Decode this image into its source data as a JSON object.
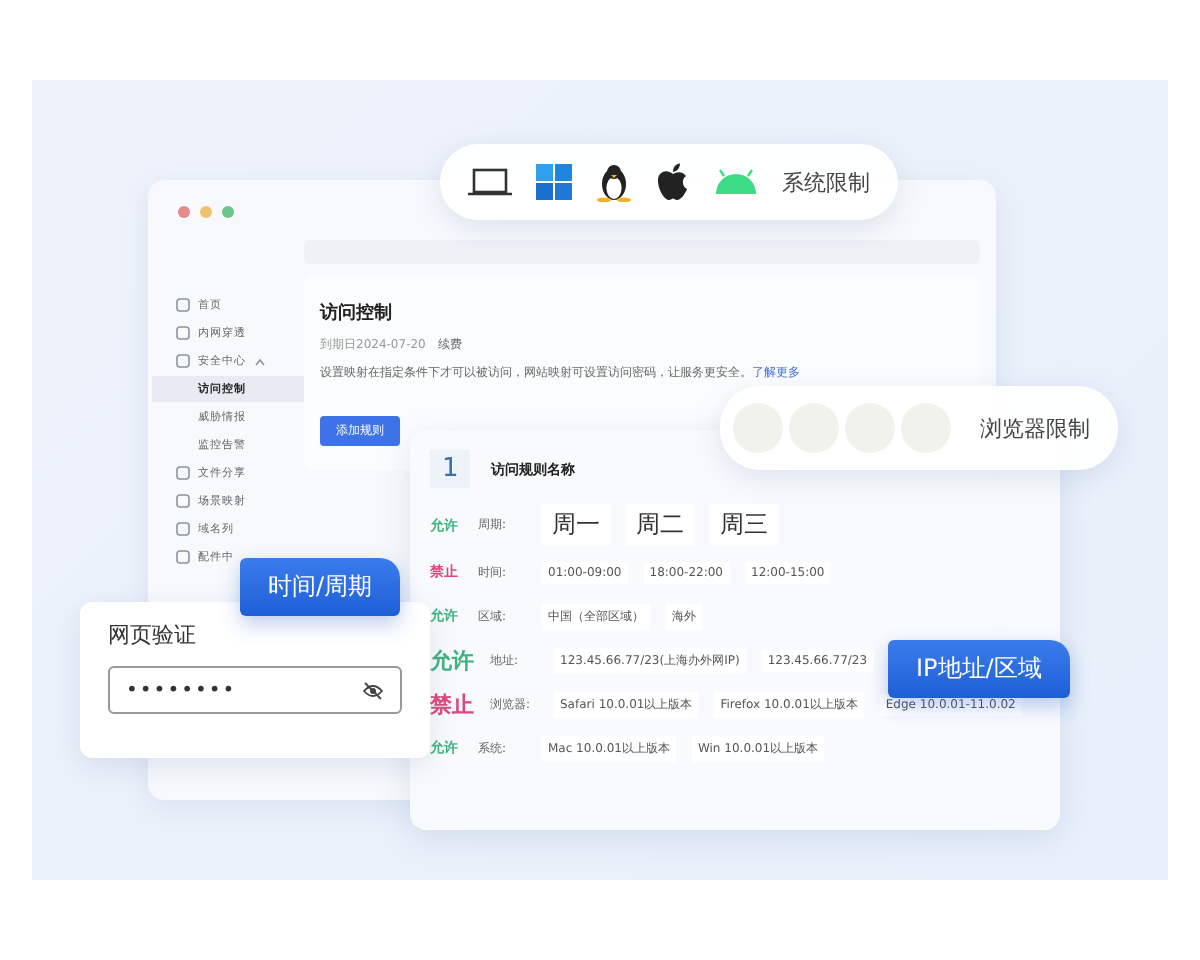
{
  "os_restriction": {
    "label": "系统限制"
  },
  "browser_restriction": {
    "label": "浏览器限制"
  },
  "sidebar": {
    "items": [
      {
        "label": "首页",
        "selected": false
      },
      {
        "label": "内网穿透",
        "selected": false
      },
      {
        "label": "安全中心",
        "selected": false,
        "expanded": true,
        "children": [
          {
            "label": "访问控制",
            "selected": true
          },
          {
            "label": "威胁情报",
            "selected": false
          },
          {
            "label": "监控告警",
            "selected": false
          }
        ]
      },
      {
        "label": "文件分享",
        "selected": false
      },
      {
        "label": "场景映射",
        "selected": false
      },
      {
        "label": "域名列",
        "selected": false
      },
      {
        "label": "配件中",
        "selected": false
      }
    ]
  },
  "page": {
    "title": "访问控制",
    "expiry": "到期日2024-07-20",
    "renew": "续费",
    "description": "设置映射在指定条件下才可以被访问，网站映射可设置访问密码，让服务更安全。",
    "learn_more": "了解更多",
    "add_button": "添加规则"
  },
  "rule": {
    "index": "1",
    "name": "访问规则名称",
    "rows": [
      {
        "status": "允许",
        "color": "#3fb27f",
        "emphasized": false,
        "label": "周期:",
        "kind": "large",
        "values": [
          "周一",
          "周二",
          "周三"
        ]
      },
      {
        "status": "禁止",
        "color": "#e0457b",
        "emphasized": false,
        "label": "时间:",
        "kind": "normal",
        "values": [
          "01:00-09:00",
          "18:00-22:00",
          "12:00-15:00"
        ]
      },
      {
        "status": "允许",
        "color": "#3fb27f",
        "emphasized": false,
        "label": "区域:",
        "kind": "normal",
        "values": [
          "中国（全部区域）",
          "海外"
        ]
      },
      {
        "status": "允许",
        "color": "#3fb27f",
        "emphasized": true,
        "label": "地址:",
        "kind": "normal",
        "values": [
          "123.45.66.77/23(上海办外网IP)",
          "123.45.66.77/23"
        ]
      },
      {
        "status": "禁止",
        "color": "#e0457b",
        "emphasized": true,
        "label": "浏览器:",
        "kind": "normal",
        "values": [
          "Safari 10.0.01以上版本",
          "Firefox 10.0.01以上版本",
          "Edge 10.0.01-11.0.02"
        ]
      },
      {
        "status": "允许",
        "color": "#3fb27f",
        "emphasized": false,
        "label": "系统:",
        "kind": "normal",
        "values": [
          "Mac 10.0.01以上版本",
          "Win 10.0.01以上版本"
        ]
      }
    ]
  },
  "time_tag": {
    "label": "时间/周期"
  },
  "ip_tag": {
    "label": "IP地址/区域"
  },
  "web_auth": {
    "title": "网页验证",
    "password": "••••••••"
  }
}
